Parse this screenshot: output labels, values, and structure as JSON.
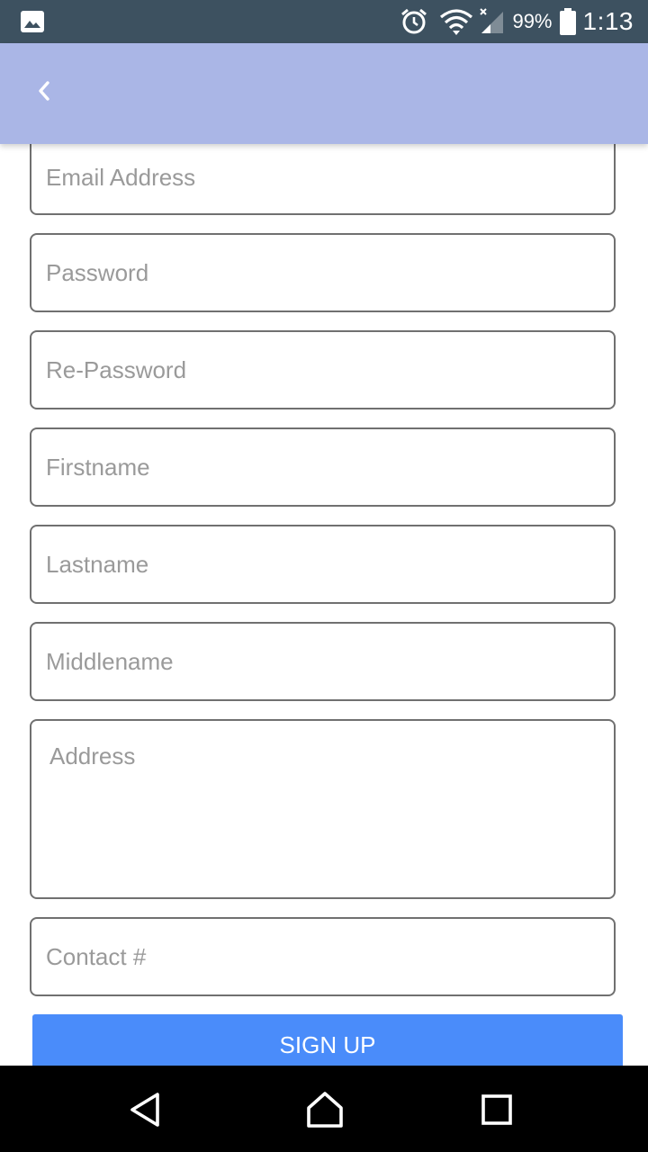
{
  "status_bar": {
    "battery_percent": "99%",
    "time": "1:13",
    "icons": [
      "image-icon",
      "alarm-icon",
      "wifi-icon",
      "signal-icon",
      "battery-icon"
    ]
  },
  "app_bar": {
    "back_icon": "chevron-left-icon",
    "color": "#aab6e6"
  },
  "form": {
    "email_placeholder": "Email Address",
    "password_placeholder": "Password",
    "repassword_placeholder": "Re-Password",
    "firstname_placeholder": "Firstname",
    "lastname_placeholder": "Lastname",
    "middlename_placeholder": "Middlename",
    "address_placeholder": "Address",
    "contact_placeholder": "Contact #",
    "signup_label": "SIGN UP",
    "signup_color": "#4a8cfa"
  },
  "nav_bar": {
    "icons": [
      "back-triangle-icon",
      "home-icon",
      "recents-icon"
    ]
  }
}
